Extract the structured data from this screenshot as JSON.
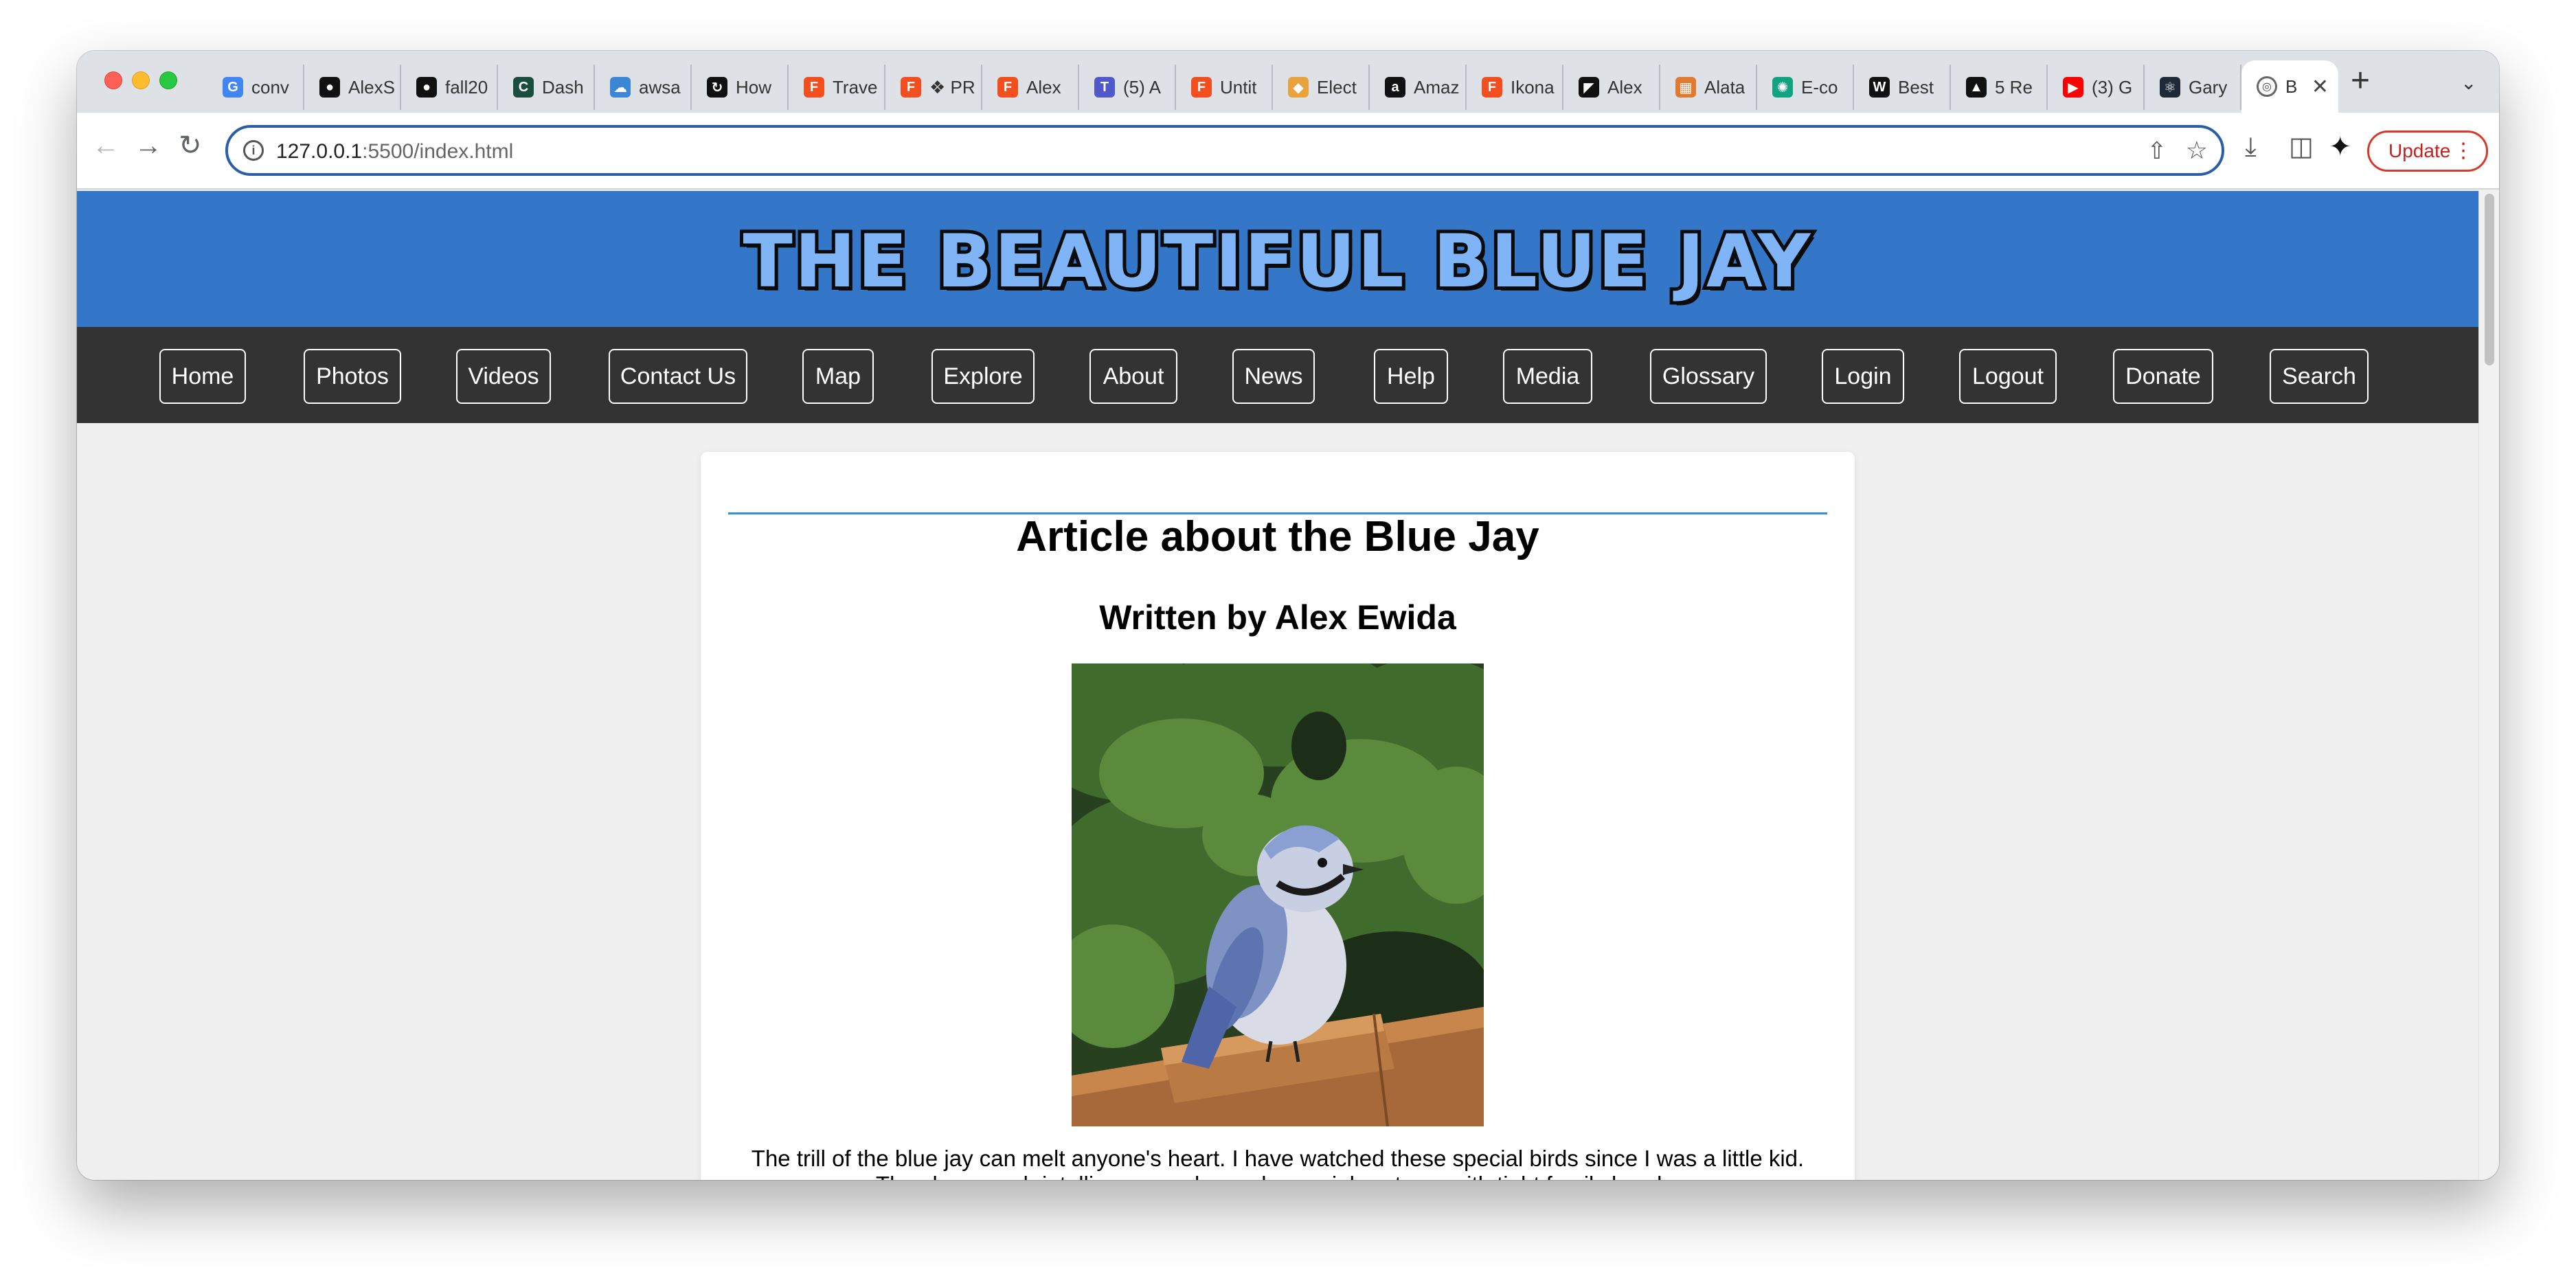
{
  "browser": {
    "tabs": [
      {
        "label": "conv",
        "icon": "google-icon",
        "color": "#4285f4",
        "glyph": "G"
      },
      {
        "label": "AlexS",
        "icon": "github-icon",
        "color": "#111111",
        "glyph": "●"
      },
      {
        "label": "fall20",
        "icon": "github-icon",
        "color": "#111111",
        "glyph": "●"
      },
      {
        "label": "Dash",
        "icon": "coursera-icon",
        "color": "#1b4d3e",
        "glyph": "C"
      },
      {
        "label": "awsa",
        "icon": "cloud-icon",
        "color": "#3c86d6",
        "glyph": "☁"
      },
      {
        "label": "How",
        "icon": "reload-icon",
        "color": "#111111",
        "glyph": "↻"
      },
      {
        "label": "Trave",
        "icon": "figma-icon",
        "color": "#f24e1e",
        "glyph": "F"
      },
      {
        "label": "❖ PR",
        "icon": "figma-icon",
        "color": "#f24e1e",
        "glyph": "F"
      },
      {
        "label": "Alex",
        "icon": "figma-icon",
        "color": "#f24e1e",
        "glyph": "F"
      },
      {
        "label": "(5) A",
        "icon": "teams-icon",
        "color": "#5059c9",
        "glyph": "T"
      },
      {
        "label": "Untit",
        "icon": "figma-icon",
        "color": "#f24e1e",
        "glyph": "F"
      },
      {
        "label": "Elect",
        "icon": "lock-icon",
        "color": "#e8a33d",
        "glyph": "◆"
      },
      {
        "label": "Amaz",
        "icon": "amazon-icon",
        "color": "#111111",
        "glyph": "a"
      },
      {
        "label": "Ikona",
        "icon": "figma-icon",
        "color": "#f24e1e",
        "glyph": "F"
      },
      {
        "label": "Alex",
        "icon": "framer-icon",
        "color": "#111111",
        "glyph": "◤"
      },
      {
        "label": "Alata",
        "icon": "apps-icon",
        "color": "#e07a2e",
        "glyph": "▦"
      },
      {
        "label": "E-co",
        "icon": "openai-icon",
        "color": "#10a37f",
        "glyph": "✺"
      },
      {
        "label": "Best",
        "icon": "webflow-icon",
        "color": "#111111",
        "glyph": "W"
      },
      {
        "label": "5 Re",
        "icon": "vercel-icon",
        "color": "#111111",
        "glyph": "▲"
      },
      {
        "label": "(3) G",
        "icon": "youtube-icon",
        "color": "#ff0000",
        "glyph": "▶"
      },
      {
        "label": "Gary",
        "icon": "react-icon",
        "color": "#1e2a38",
        "glyph": "⚛"
      }
    ],
    "active_tab": {
      "label": "B",
      "icon": "globe-icon",
      "close": "✕"
    },
    "new_tab": "+",
    "tab_search": "⌄",
    "url_host": "127.0.0.1",
    "url_rest": ":5500/index.html",
    "update_label": "Update",
    "update_menu": "⋮"
  },
  "page": {
    "site_title": "THE BEAUTIFUL BLUE JAY",
    "nav": [
      "Home",
      "Photos",
      "Videos",
      "Contact Us",
      "Map",
      "Explore",
      "About",
      "News",
      "Help",
      "Media",
      "Glossary",
      "Login",
      "Logout",
      "Donate",
      "Search"
    ],
    "article": {
      "title": "Article about the Blue Jay",
      "author": "Written by Alex Ewida",
      "body": "The trill of the blue jay can melt anyone's heart. I have watched these special birds since I was a little kid. They have such intelligence and complex social systems with tight family bonds."
    }
  },
  "colors": {
    "header_blue": "#3477c8",
    "nav_dark": "#333333",
    "title_fill": "#7fb4f6",
    "rule_blue": "#3a8fcf",
    "page_bg": "#efefef"
  }
}
